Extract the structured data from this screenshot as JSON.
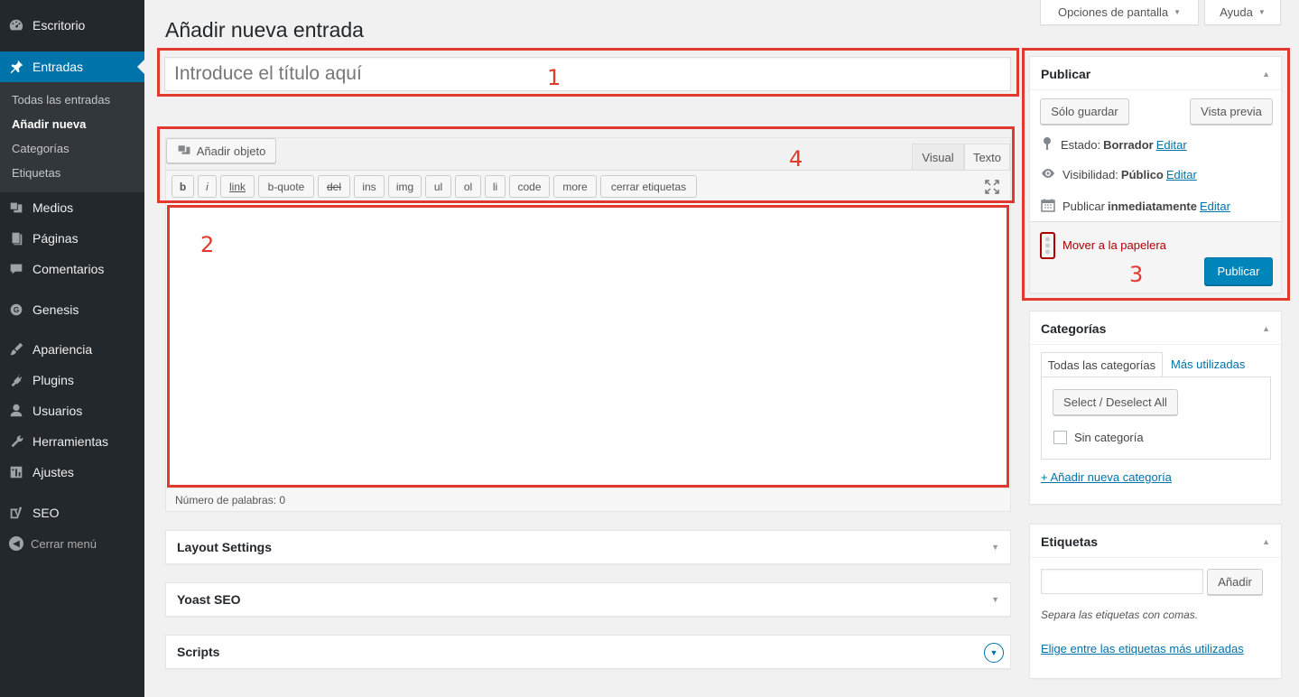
{
  "sidebar": {
    "items": [
      {
        "label": "Escritorio",
        "icon": "dashboard-icon"
      },
      {
        "label": "Entradas",
        "icon": "pin-icon"
      },
      {
        "label": "Medios",
        "icon": "media-icon"
      },
      {
        "label": "Páginas",
        "icon": "page-icon"
      },
      {
        "label": "Comentarios",
        "icon": "comment-icon"
      },
      {
        "label": "Genesis",
        "icon": "genesis-icon"
      },
      {
        "label": "Apariencia",
        "icon": "brush-icon"
      },
      {
        "label": "Plugins",
        "icon": "plugin-icon"
      },
      {
        "label": "Usuarios",
        "icon": "user-icon"
      },
      {
        "label": "Herramientas",
        "icon": "wrench-icon"
      },
      {
        "label": "Ajustes",
        "icon": "settings-icon"
      },
      {
        "label": "SEO",
        "icon": "yoast-icon"
      }
    ],
    "submenu": [
      "Todas las entradas",
      "Añadir nueva",
      "Categorías",
      "Etiquetas"
    ],
    "collapse_label": "Cerrar menú"
  },
  "top": {
    "screen_options": "Opciones de pantalla",
    "help": "Ayuda"
  },
  "page": {
    "title": "Añadir nueva entrada",
    "title_placeholder": "Introduce el título aquí"
  },
  "editor": {
    "add_media": "Añadir objeto",
    "tab_visual": "Visual",
    "tab_text": "Texto",
    "quicktags": [
      "b",
      "i",
      "link",
      "b-quote",
      "del",
      "ins",
      "img",
      "ul",
      "ol",
      "li",
      "code",
      "more",
      "cerrar etiquetas"
    ],
    "word_count": "Número de palabras: 0"
  },
  "metaboxes": {
    "layout": "Layout Settings",
    "yoast": "Yoast SEO",
    "scripts": "Scripts"
  },
  "publish": {
    "title": "Publicar",
    "save_draft": "Sólo guardar",
    "preview": "Vista previa",
    "status_label": "Estado:",
    "status_value": "Borrador",
    "visibility_label": "Visibilidad:",
    "visibility_value": "Público",
    "publish_label": "Publicar",
    "publish_value": "inmediatamente",
    "edit": "Editar",
    "trash": "Mover a la papelera",
    "publish_button": "Publicar"
  },
  "categories": {
    "title": "Categorías",
    "tab_all": "Todas las categorías",
    "tab_most_used": "Más utilizadas",
    "select_all": "Select / Deselect All",
    "uncategorized": "Sin categoría",
    "add_new": "+ Añadir nueva categoría"
  },
  "tags": {
    "title": "Etiquetas",
    "add_button": "Añadir",
    "hint": "Separa las etiquetas con comas.",
    "choose_link": "Elige entre las etiquetas más utilizadas"
  },
  "annotations": [
    "1",
    "2",
    "3",
    "4"
  ],
  "colors": {
    "sidebar_bg": "#23282d",
    "accent": "#0073aa",
    "annotation": "#e2392e"
  }
}
